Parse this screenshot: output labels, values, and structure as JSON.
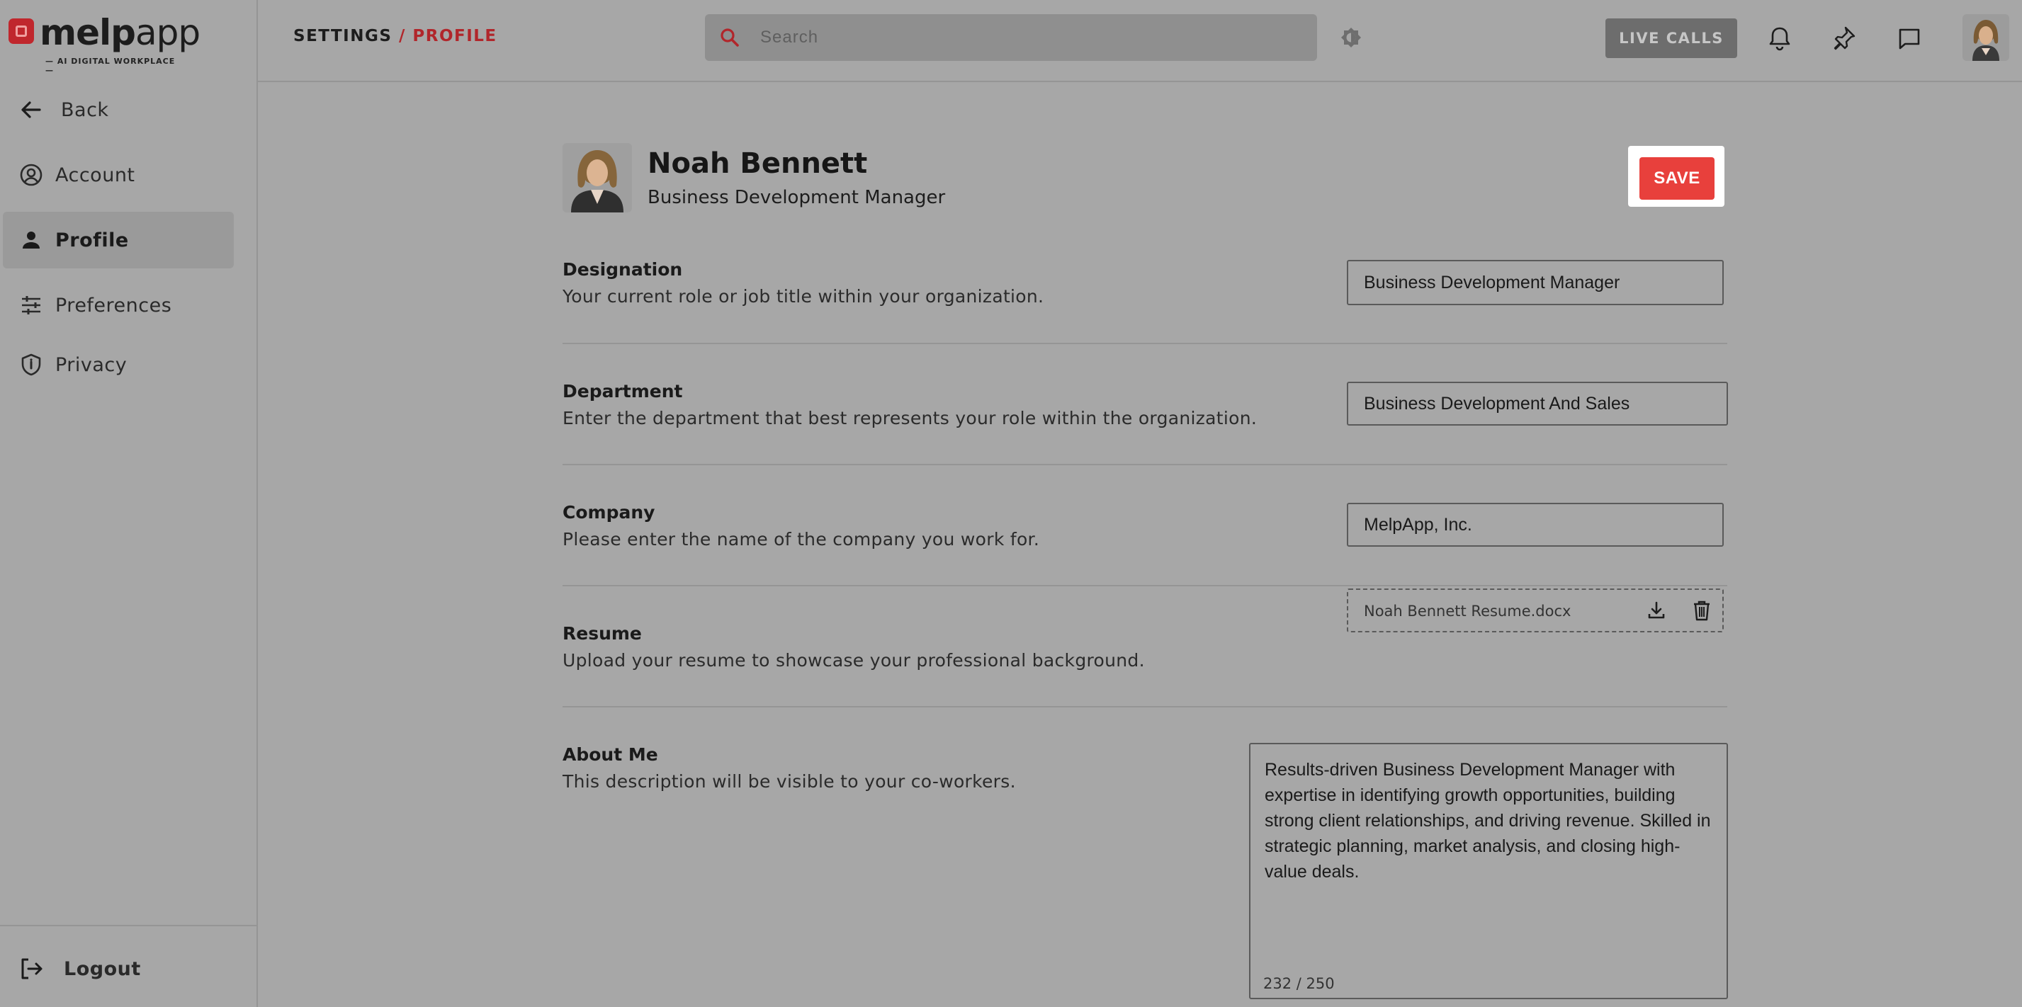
{
  "brand": {
    "name_bold": "melp",
    "name_light": "app",
    "tagline": "— AI DIGITAL WORKPLACE —",
    "accent_color": "#c0272d"
  },
  "sidebar": {
    "back_label": "Back",
    "items": [
      {
        "label": "Account",
        "icon": "account-circle-icon"
      },
      {
        "label": "Profile",
        "icon": "person-icon",
        "active": true
      },
      {
        "label": "Preferences",
        "icon": "sliders-icon"
      },
      {
        "label": "Privacy",
        "icon": "shield-icon"
      }
    ],
    "logout_label": "Logout"
  },
  "header": {
    "breadcrumb_root": "SETTINGS",
    "breadcrumb_sep": "/",
    "breadcrumb_current": "PROFILE",
    "search_placeholder": "Search",
    "live_calls_label": "LIVE CALLS",
    "icons": [
      "theme-toggle-icon",
      "bell-icon",
      "pin-icon",
      "chat-icon"
    ]
  },
  "profile": {
    "name": "Noah Bennett",
    "title": "Business Development Manager",
    "save_label": "SAVE"
  },
  "fields": {
    "designation": {
      "label": "Designation",
      "description": "Your current role or job title within your organization.",
      "value": "Business Development Manager"
    },
    "department": {
      "label": "Department",
      "description": "Enter the department that best represents your role within the organization.",
      "value": "Business Development And Sales"
    },
    "company": {
      "label": "Company",
      "description": "Please enter the name of the company you work for.",
      "value": "MelpApp, Inc."
    },
    "resume": {
      "label": "Resume",
      "description": "Upload your resume to showcase your professional background.",
      "file_name": "Noah Bennett Resume.docx"
    },
    "about": {
      "label": "About Me",
      "description": "This description will be visible to your co-workers.",
      "value": "Results-driven Business Development Manager with expertise in identifying growth opportunities, building strong client relationships, and driving revenue. Skilled in strategic planning, market analysis, and closing high-value deals.",
      "counter": "232 / 250"
    }
  }
}
